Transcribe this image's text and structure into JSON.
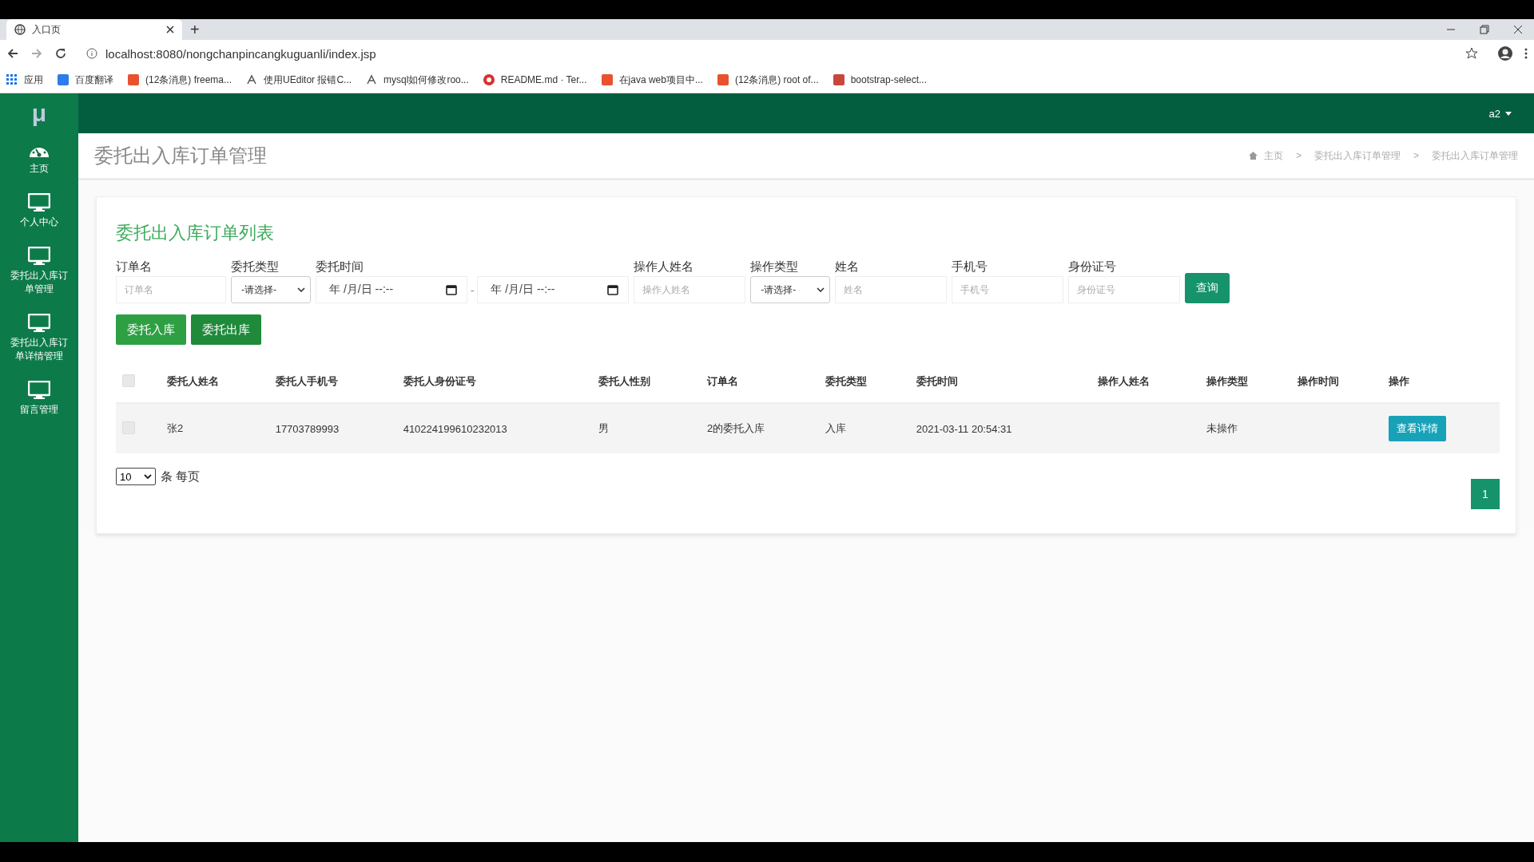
{
  "browser": {
    "tab_title": "入口页",
    "new_tab": "+",
    "url": "localhost:8080/nongchanpincangkuguanli/index.jsp",
    "bookmarks": [
      {
        "label": "应用",
        "kind": "apps",
        "color": "#1a73e8"
      },
      {
        "label": "百度翻译",
        "kind": "square",
        "color": "#2b7de9"
      },
      {
        "label": "(12条消息) freema...",
        "kind": "square",
        "color": "#e8522f"
      },
      {
        "label": "使用UEditor 报错C...",
        "kind": "glyph",
        "color": "#555555"
      },
      {
        "label": "mysql如何修改roo...",
        "kind": "glyph",
        "color": "#555555"
      },
      {
        "label": "README.md · Ter...",
        "kind": "circle",
        "color": "#d9302c"
      },
      {
        "label": "在java web项目中...",
        "kind": "square",
        "color": "#e8522f"
      },
      {
        "label": "(12条消息) root of...",
        "kind": "square",
        "color": "#e8522f"
      },
      {
        "label": "bootstrap-select...",
        "kind": "square",
        "color": "#c8463c"
      }
    ]
  },
  "header": {
    "logo": "μ",
    "user": "a2"
  },
  "sidebar": {
    "items": [
      {
        "label": "主页",
        "kind": "gauge"
      },
      {
        "label": "个人中心",
        "kind": "monitor"
      },
      {
        "label": "委托出入库订单管理",
        "kind": "monitor"
      },
      {
        "label": "委托出入库订单详情管理",
        "kind": "monitor"
      },
      {
        "label": "留言管理",
        "kind": "monitor"
      }
    ]
  },
  "page_title": "委托出入库订单管理",
  "breadcrumb": {
    "separator": ">",
    "items": [
      "主页",
      "委托出入库订单管理",
      "委托出入库订单管理"
    ]
  },
  "panel_title": "委托出入库订单列表",
  "filters": [
    {
      "label": "订单名",
      "kind": "text",
      "placeholder": "订单名"
    },
    {
      "label": "委托类型",
      "kind": "select",
      "value": "-请选择-"
    },
    {
      "label": "委托时间",
      "kind": "daterange",
      "from": "年 /月/日 --:--",
      "separator": "-",
      "to": "年 /月/日 --:--"
    },
    {
      "label": "操作人姓名",
      "kind": "text",
      "placeholder": "操作人姓名"
    },
    {
      "label": "操作类型",
      "kind": "select",
      "value": "-请选择-"
    },
    {
      "label": "姓名",
      "kind": "text",
      "placeholder": "姓名"
    },
    {
      "label": "手机号",
      "kind": "text",
      "placeholder": "手机号"
    },
    {
      "label": "身份证号",
      "kind": "text",
      "placeholder": "身份证号"
    }
  ],
  "search_button": "查询",
  "actions": [
    "委托入库",
    "委托出库"
  ],
  "table": {
    "select_all_checked": false,
    "columns": [
      "委托人姓名",
      "委托人手机号",
      "委托人身份证号",
      "委托人性别",
      "订单名",
      "委托类型",
      "委托时间",
      "操作人姓名",
      "操作类型",
      "操作时间",
      "操作"
    ],
    "rows": [
      {
        "checked": false,
        "cells": [
          "张2",
          "17703789993",
          "410224199610232013",
          "男",
          "2的委托入库",
          "入库",
          "2021-03-11 20:54:31",
          "",
          "未操作",
          ""
        ],
        "action": "查看详情"
      }
    ]
  },
  "pagination": {
    "page_size": "10",
    "unit": "条 每页",
    "pages": [
      {
        "label": "1",
        "selected": true
      }
    ]
  }
}
